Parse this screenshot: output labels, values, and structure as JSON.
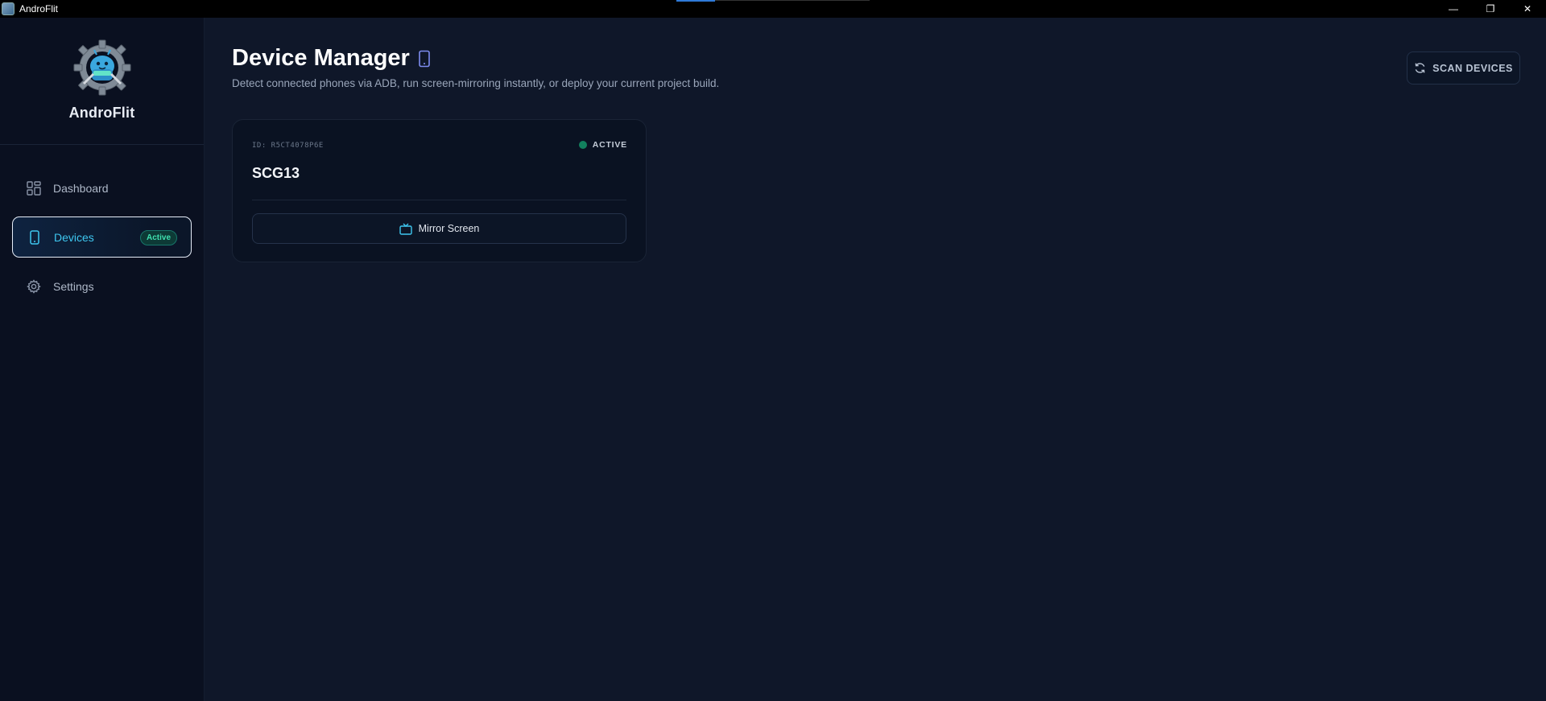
{
  "window": {
    "title": "AndroFlit",
    "minimize_glyph": "—",
    "restore_glyph": "❐",
    "close_glyph": "✕"
  },
  "sidebar": {
    "brand_name": "AndroFlit",
    "items": [
      {
        "label": "Dashboard",
        "icon": "dashboard-grid-icon"
      },
      {
        "label": "Devices",
        "icon": "phone-icon",
        "badge": "Active"
      },
      {
        "label": "Settings",
        "icon": "gear-icon"
      }
    ]
  },
  "main": {
    "title": "Device Manager",
    "subtitle": "Detect connected phones via ADB, run screen-mirroring instantly, or deploy your current project build.",
    "scan_button_label": "SCAN DEVICES"
  },
  "devices": [
    {
      "id_label": "ID: R5CT4078P6E",
      "status": "ACTIVE",
      "name": "SCG13",
      "mirror_button_label": "Mirror Screen"
    }
  ],
  "colors": {
    "background": "#0f1729",
    "sidebar": "#0a1020",
    "accent": "#3ec7f0",
    "status_active": "#12805e",
    "badge_text": "#3fe0b0"
  }
}
